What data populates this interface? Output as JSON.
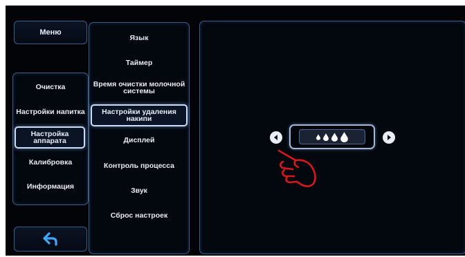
{
  "nav": {
    "menu": "Меню",
    "items": [
      "Очистка",
      "Настройки напитка",
      "Настройка аппарата",
      "Калибровка",
      "Информация"
    ],
    "selected_index": 2,
    "back_icon": "back-arrow-icon"
  },
  "submenu": {
    "items": [
      "Язык",
      "Таймер",
      "Время очистки молочной системы",
      "Настройки удаления накипи",
      "Дисплей",
      "Контроль процесса",
      "Звук",
      "Сброс настроек"
    ],
    "selected_index": 3
  },
  "setting": {
    "water_hardness_level": 4,
    "water_hardness_max": 4,
    "drop_icon": "water-drop-icon",
    "prev_icon": "chevron-left-icon",
    "next_icon": "chevron-right-icon",
    "accent_color": "#3c5c86",
    "hand_color": "#d8181c"
  }
}
